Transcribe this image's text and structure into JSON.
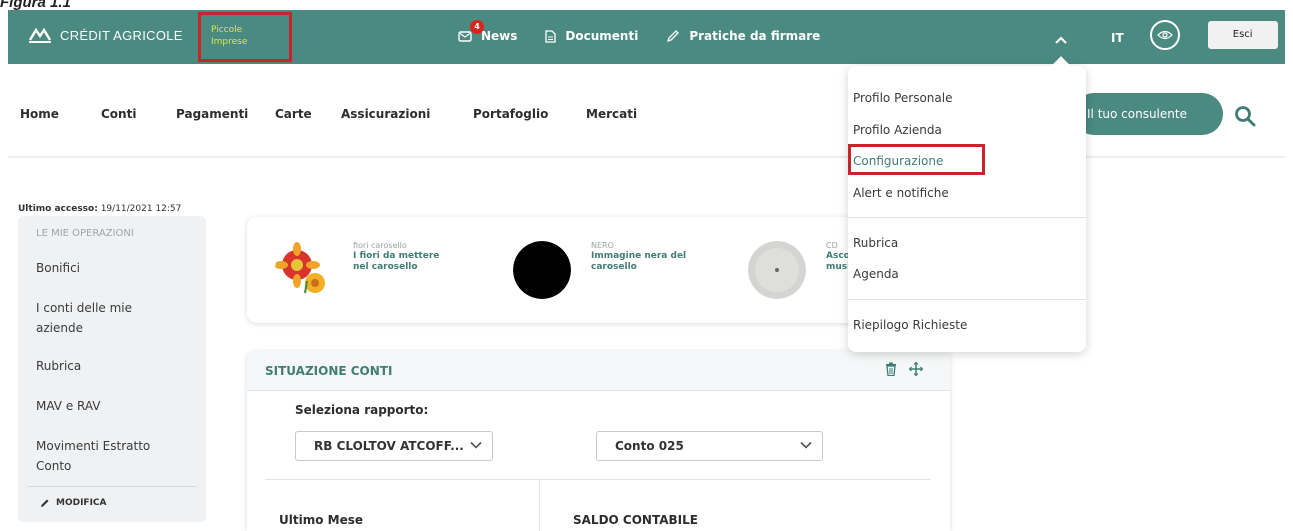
{
  "caption": "Figura 1.1",
  "header": {
    "brand": "CRÉDIT AGRICOLE",
    "segment_line1": "Piccole",
    "segment_line2": "Imprese",
    "news_count": "4",
    "news_label": "News",
    "documents_label": "Documenti",
    "sign_label": "Pratiche da firmare",
    "lang": "IT",
    "logout_label": "Esci",
    "accent_color": "#4a8a80",
    "highlight_color": "#c7252b"
  },
  "nav": {
    "items": [
      "Home",
      "Conti",
      "Pagamenti",
      "Carte",
      "Assicurazioni",
      "Portafoglio",
      "Mercati"
    ],
    "consultant_label": "Il tuo consulente"
  },
  "last_access": {
    "label": "Ultimo accesso:",
    "value": "19/11/2021 12:57"
  },
  "sidebar": {
    "title": "LE MIE OPERAZIONI",
    "items": [
      "Bonifici",
      "I conti delle mie aziende",
      "Rubrica",
      "MAV e RAV",
      "Movimenti Estratto Conto"
    ],
    "edit_label": "MODIFICA"
  },
  "carousel": {
    "items": [
      {
        "subtitle": "fiori carosello",
        "title": "I fiori da mettere nel carosello",
        "icon": "flowers-image"
      },
      {
        "subtitle": "NERO",
        "title": "Immagine nera del carosello",
        "icon": "black-circle-image"
      },
      {
        "subtitle": "CD",
        "title": "Asco musi",
        "icon": "cd-image"
      }
    ]
  },
  "accounts": {
    "title": "SITUAZIONE CONTI",
    "select_label": "Seleziona rapporto:",
    "relation_value": "RB CLOLTOV ATCOFF...",
    "account_value": "Conto 025",
    "last_month_label": "Ultimo Mese",
    "balance_label": "SALDO CONTABILE"
  },
  "menu": {
    "items_group1": [
      "Profilo Personale",
      "Profilo Azienda",
      "Configurazione",
      "Alert e notifiche"
    ],
    "items_group2": [
      "Rubrica",
      "Agenda"
    ],
    "items_group3": [
      "Riepilogo Richieste"
    ],
    "selected": "Configurazione"
  }
}
